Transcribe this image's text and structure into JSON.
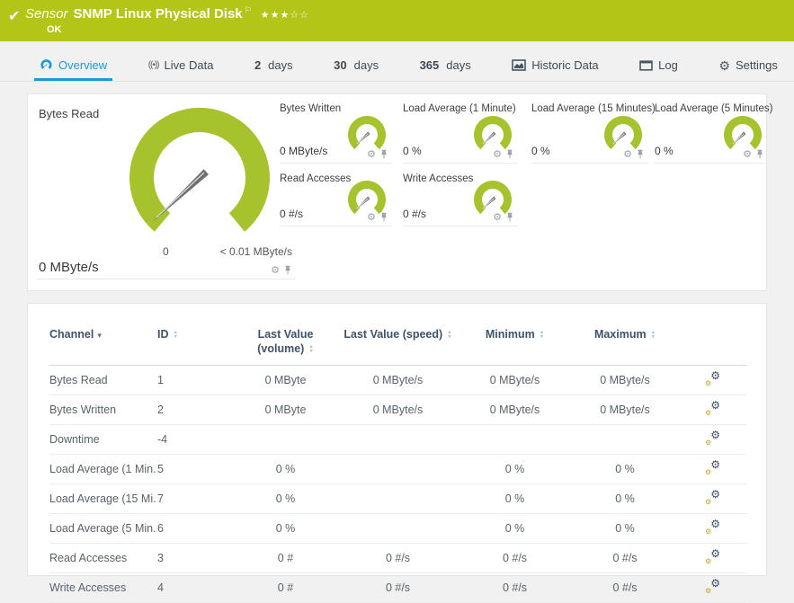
{
  "window": {
    "title_kind": "Sensor",
    "title": "SNMP Linux Physical Disk",
    "status": "OK",
    "rating_filled": 3,
    "rating_total": 5
  },
  "tabs": [
    {
      "label": "Overview",
      "icon": "gauge-icon",
      "active": true
    },
    {
      "label": "Live Data",
      "icon": "broadcast-icon",
      "active": false
    },
    {
      "prefix": "2",
      "label": "days",
      "active": false
    },
    {
      "prefix": "30",
      "label": "days",
      "active": false
    },
    {
      "prefix": "365",
      "label": "days",
      "active": false
    },
    {
      "label": "Historic Data",
      "icon": "area-chart-icon",
      "active": false
    },
    {
      "label": "Log",
      "icon": "window-icon",
      "active": false
    },
    {
      "label": "Settings",
      "icon": "gear-icon",
      "active": false
    }
  ],
  "gauges": {
    "primary": {
      "title": "Bytes Read",
      "value": "0 MByte/s",
      "scale_start": "0",
      "scale_end": "< 0.01 MByte/s"
    },
    "small": [
      {
        "title": "Bytes Written",
        "value": "0 MByte/s"
      },
      {
        "title": "Load Average (1 Minute)",
        "value": "0 %"
      },
      {
        "title": "Load Average (15 Minutes)",
        "value": "0 %"
      },
      {
        "title": "Load Average (5 Minutes)",
        "value": "0 %"
      },
      {
        "title": "Read Accesses",
        "value": "0 #/s"
      },
      {
        "title": "Write Accesses",
        "value": "0 #/s"
      }
    ]
  },
  "table": {
    "columns": {
      "channel": "Channel",
      "id": "ID",
      "last_volume": "Last Value (volume)",
      "last_speed": "Last Value (speed)",
      "min": "Minimum",
      "max": "Maximum"
    },
    "rows": [
      {
        "channel": "Bytes Read",
        "id": "1",
        "last_volume": "0 MByte",
        "last_speed": "0 MByte/s",
        "min": "0 MByte/s",
        "max": "0 MByte/s"
      },
      {
        "channel": "Bytes Written",
        "id": "2",
        "last_volume": "0 MByte",
        "last_speed": "0 MByte/s",
        "min": "0 MByte/s",
        "max": "0 MByte/s"
      },
      {
        "channel": "Downtime",
        "id": "-4",
        "last_volume": "",
        "last_speed": "",
        "min": "",
        "max": ""
      },
      {
        "channel": "Load Average (1 Min...",
        "id": "5",
        "last_volume": "0 %",
        "last_speed": "",
        "min": "0 %",
        "max": "0 %"
      },
      {
        "channel": "Load Average (15 Mi...",
        "id": "7",
        "last_volume": "0 %",
        "last_speed": "",
        "min": "0 %",
        "max": "0 %"
      },
      {
        "channel": "Load Average (5 Min...",
        "id": "6",
        "last_volume": "0 %",
        "last_speed": "",
        "min": "0 %",
        "max": "0 %"
      },
      {
        "channel": "Read Accesses",
        "id": "3",
        "last_volume": "0 #",
        "last_speed": "0 #/s",
        "min": "0 #/s",
        "max": "0 #/s"
      },
      {
        "channel": "Write Accesses",
        "id": "4",
        "last_volume": "0 #",
        "last_speed": "0 #/s",
        "min": "0 #/s",
        "max": "0 #/s"
      }
    ]
  },
  "colors": {
    "status_green": "#b3c516",
    "gauge_green": "#a6c22d",
    "accent_blue": "#1c9ad6"
  }
}
